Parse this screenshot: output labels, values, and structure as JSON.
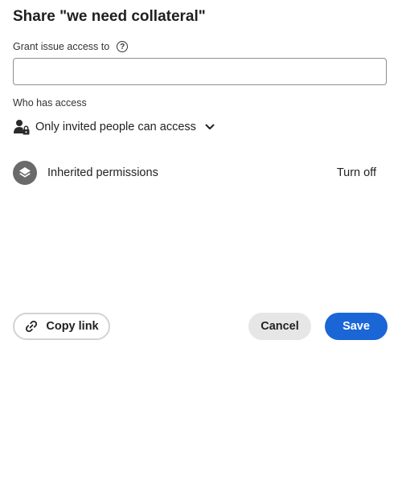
{
  "dialog": {
    "title": "Share \"we need collateral\""
  },
  "grant": {
    "label": "Grant issue access to",
    "help_icon": "question-circle-icon",
    "input_value": "",
    "input_placeholder": ""
  },
  "access": {
    "section_label": "Who has access",
    "icon": "user-lock-icon",
    "selected": "Only invited people can access",
    "chevron_icon": "chevron-down-icon"
  },
  "inherited": {
    "icon": "layers-icon",
    "label": "Inherited permissions",
    "action": "Turn off"
  },
  "footer": {
    "copy_link_icon": "link-icon",
    "copy_link_label": "Copy link",
    "cancel_label": "Cancel",
    "save_label": "Save"
  },
  "colors": {
    "primary": "#1a66d6",
    "secondary_button": "#e6e6e6",
    "icon_grey": "#6a6a6a",
    "text": "#222222"
  }
}
